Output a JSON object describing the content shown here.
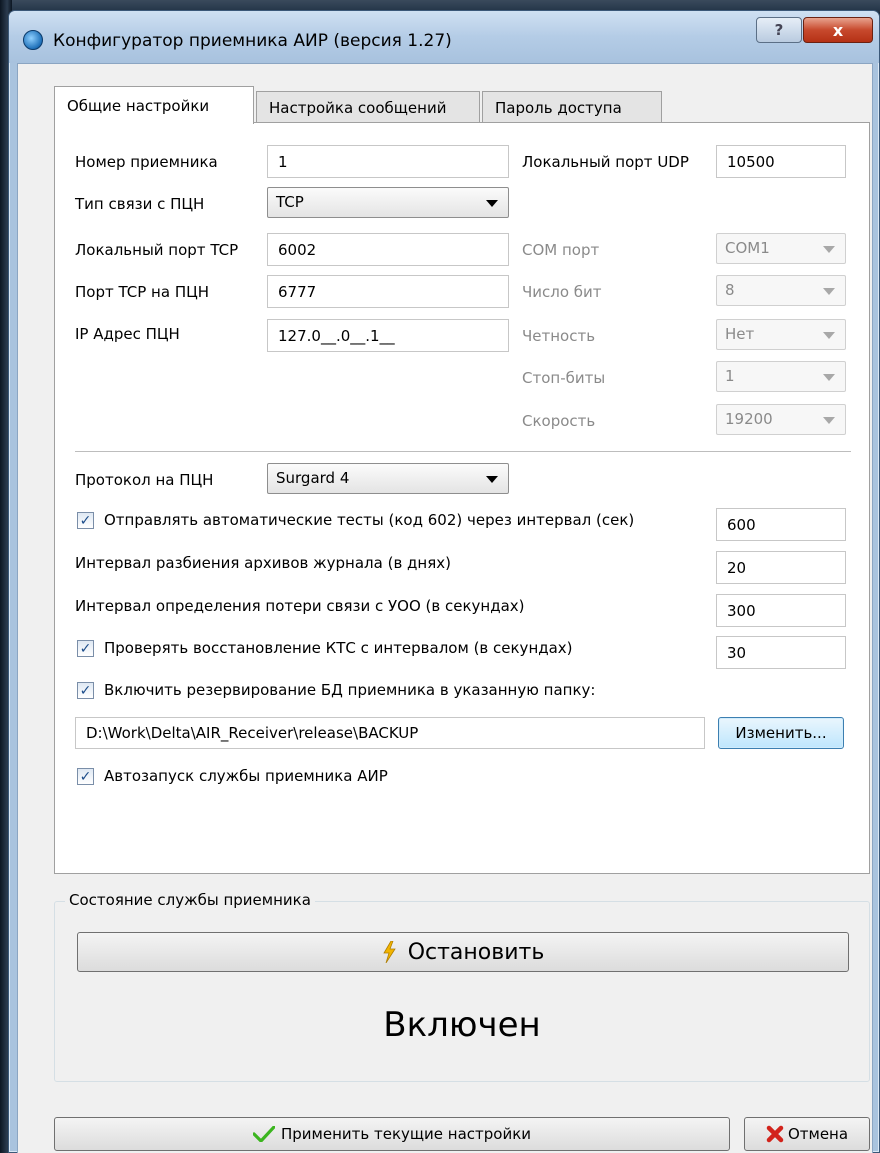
{
  "window": {
    "title": "Конфигуратор приемника АИР (версия 1.27)",
    "help_label": "?",
    "close_label": "x"
  },
  "tabs": [
    {
      "label": "Общие настройки",
      "active": true
    },
    {
      "label": "Настройка сообщений",
      "active": false
    },
    {
      "label": "Пароль доступа",
      "active": false
    }
  ],
  "general": {
    "receiver_number_label": "Номер приемника",
    "receiver_number": "1",
    "udp_port_label": "Локальный порт UDP",
    "udp_port": "10500",
    "link_type_label": "Тип связи с ПЦН",
    "link_type": "TCP",
    "tcp_local_port_label": "Локальный порт TCP",
    "tcp_local_port": "6002",
    "tcp_pcn_port_label": "Порт TCP на ПЦН",
    "tcp_pcn_port": "6777",
    "ip_label": "IP Адрес ПЦН",
    "ip_value": "127.0__.0__.1__",
    "com_port_label": "COM порт",
    "com_port": "COM1",
    "bits_label": "Число бит",
    "bits": "8",
    "parity_label": "Четность",
    "parity": "Нет",
    "stop_bits_label": "Стоп-биты",
    "stop_bits": "1",
    "speed_label": "Скорость",
    "speed": "19200",
    "protocol_label": "Протокол на ПЦН",
    "protocol": "Surgard 4",
    "auto_tests_label": "Отправлять автоматические тесты (код 602) через интервал (сек)",
    "auto_tests_checked": true,
    "auto_tests_value": "600",
    "archive_interval_label": "Интервал разбиения архивов журнала (в днях)",
    "archive_interval_value": "20",
    "loss_interval_label": "Интервал определения потери связи с УОО (в секундах)",
    "loss_interval_value": "300",
    "kts_check_label": "Проверять восстановление КТС с интервалом (в секундах)",
    "kts_check_checked": true,
    "kts_check_value": "30",
    "backup_label": "Включить резервирование БД приемника в указанную папку:",
    "backup_checked": true,
    "backup_path": "D:\\Work\\Delta\\AIR_Receiver\\release\\BACKUP",
    "change_button": "Изменить...",
    "autostart_label": "Автозапуск службы приемника АИР",
    "autostart_checked": true
  },
  "service": {
    "group_title": "Состояние службы приемника",
    "stop_button": "Остановить",
    "status_text": "Включен"
  },
  "footer": {
    "apply_button": "Применить текущие настройки",
    "cancel_button": "Отмена"
  },
  "colors": {
    "check_green": "#3bb51f",
    "cancel_red": "#d2231b",
    "lightning": "#f2b400"
  },
  "icons": [
    "app-globe-icon",
    "help-icon",
    "close-icon",
    "lightning-icon",
    "checkmark-icon",
    "cancel-x-icon",
    "dropdown-arrow-icon"
  ]
}
